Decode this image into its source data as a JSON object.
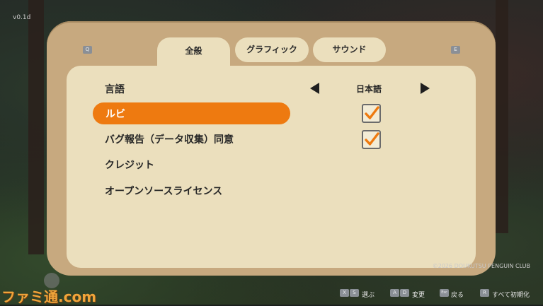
{
  "version": "v0.1d",
  "tabs": [
    {
      "label": "全般",
      "active": true
    },
    {
      "label": "グラフィック",
      "active": false
    },
    {
      "label": "サウンド",
      "active": false
    }
  ],
  "nav_keys": {
    "prev": "Q",
    "next": "E"
  },
  "settings": [
    {
      "label": "言語",
      "value": "日本語"
    },
    {
      "label": "ルビ",
      "checked": true,
      "selected": true
    },
    {
      "label": "バグ報告（データ収集）同意",
      "checked": true
    },
    {
      "label": "クレジット"
    },
    {
      "label": "オープンソースライセンス"
    }
  ],
  "copyright": "©2026 DOUKUTSU PENGUIN CLUB",
  "hints": [
    {
      "keys": [
        "X",
        "S"
      ],
      "label": "選ぶ"
    },
    {
      "keys": [
        "A",
        "D"
      ],
      "label": "変更"
    },
    {
      "keys": [
        "Esc"
      ],
      "label": "戻る"
    },
    {
      "keys": [
        "R"
      ],
      "label": "すべて初期化"
    }
  ],
  "watermark": "ファミ通.com",
  "colors": {
    "accent": "#ee7a10",
    "panel": "#c7a97f",
    "inner": "#ebdfbd"
  }
}
